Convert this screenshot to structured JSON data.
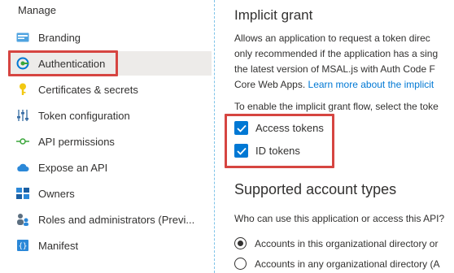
{
  "sidebar": {
    "section_label": "Manage",
    "items": [
      {
        "label": "Branding",
        "icon": "branding-icon"
      },
      {
        "label": "Authentication",
        "icon": "authentication-icon",
        "active": true
      },
      {
        "label": "Certificates & secrets",
        "icon": "key-icon"
      },
      {
        "label": "Token configuration",
        "icon": "token-config-icon"
      },
      {
        "label": "API permissions",
        "icon": "api-permissions-icon"
      },
      {
        "label": "Expose an API",
        "icon": "cloud-icon"
      },
      {
        "label": "Owners",
        "icon": "owners-icon"
      },
      {
        "label": "Roles and administrators (Previ...",
        "icon": "roles-icon"
      },
      {
        "label": "Manifest",
        "icon": "manifest-icon"
      }
    ]
  },
  "main": {
    "implicit_grant": {
      "heading": "Implicit grant",
      "description_lines": [
        "Allows an application to request a token direc",
        "only recommended if the application has a sing",
        "the latest version of MSAL.js with Auth Code F",
        "Core Web Apps."
      ],
      "learn_more": "Learn more about the implicit",
      "enable_text": "To enable the implicit grant flow, select the toke",
      "checkboxes": [
        {
          "label": "Access tokens",
          "checked": true
        },
        {
          "label": "ID tokens",
          "checked": true
        }
      ]
    },
    "account_types": {
      "heading": "Supported account types",
      "question": "Who can use this application or access this API?",
      "options": [
        {
          "label": "Accounts in this organizational directory or",
          "selected": true
        },
        {
          "label": "Accounts in any organizational directory (A",
          "selected": false
        }
      ]
    }
  },
  "colors": {
    "accent": "#0078d4",
    "highlight": "#d64541",
    "active_bg": "#edebe9"
  }
}
